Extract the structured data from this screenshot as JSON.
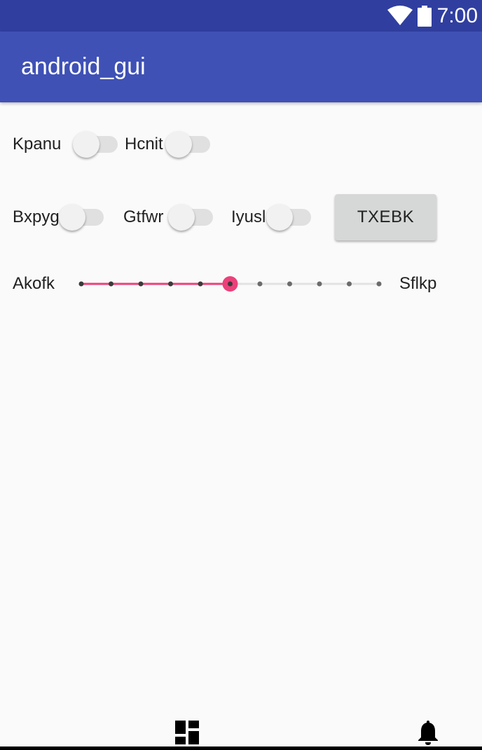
{
  "status_bar": {
    "time": "7:00",
    "icons": [
      "wifi-icon",
      "battery-icon"
    ]
  },
  "app_bar": {
    "title": "android_gui"
  },
  "switches": [
    {
      "label": "Kpanu",
      "checked": false
    },
    {
      "label": "Hcnit",
      "checked": false
    },
    {
      "label": "Bxpyg",
      "checked": false
    },
    {
      "label": "Gtfwr",
      "checked": false
    },
    {
      "label": "Iyusl",
      "checked": false
    }
  ],
  "button": {
    "label": "TXEBK"
  },
  "seekbar": {
    "left_label": "Akofk",
    "right_label": "Sflkp",
    "max": 10,
    "progress": 5,
    "accent_color": "#ec407a"
  },
  "nav_bar": {
    "icons": [
      "dashboard-icon",
      "notifications-icon"
    ]
  },
  "colors": {
    "status_bar": "#303f9f",
    "app_bar": "#3f51b5",
    "background": "#fafafa",
    "accent": "#ec407a"
  }
}
